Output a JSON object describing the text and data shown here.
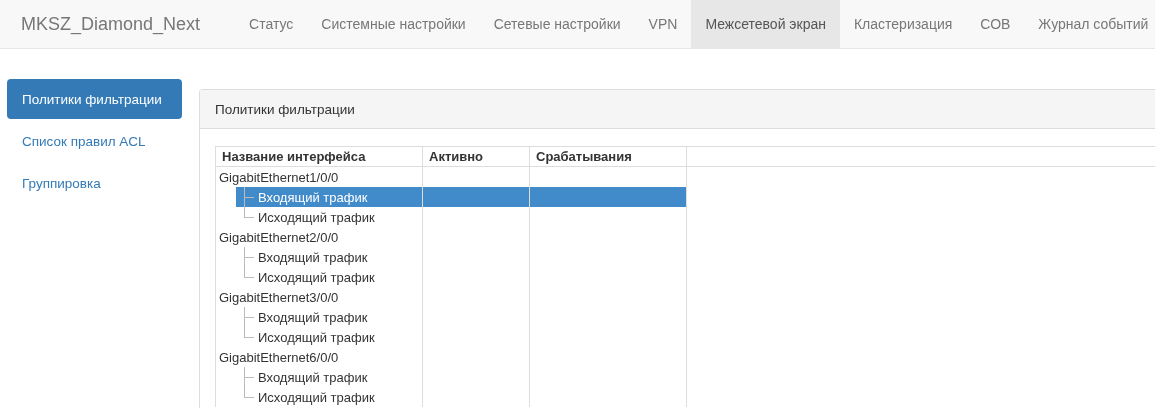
{
  "navbar": {
    "brand": "MKSZ_Diamond_Next",
    "tabs": [
      {
        "label": "Статус",
        "selected": false
      },
      {
        "label": "Системные настройки",
        "selected": false
      },
      {
        "label": "Сетевые настройки",
        "selected": false
      },
      {
        "label": "VPN",
        "selected": false
      },
      {
        "label": "Межсетевой экран",
        "selected": true
      },
      {
        "label": "Кластеризация",
        "selected": false
      },
      {
        "label": "СОВ",
        "selected": false
      },
      {
        "label": "Журнал событий",
        "selected": false
      }
    ]
  },
  "sidebar": {
    "items": [
      {
        "label": "Политики фильтрации",
        "selected": true
      },
      {
        "label": "Список правил ACL",
        "selected": false
      },
      {
        "label": "Группировка",
        "selected": false
      }
    ]
  },
  "panel": {
    "title": "Политики фильтрации"
  },
  "table": {
    "columns": [
      "Название интерфейса",
      "Активно",
      "Срабатывания"
    ],
    "rows": [
      {
        "name": "GigabitEthernet1/0/0",
        "children": [
          {
            "name": "Входящий трафик",
            "selected": true
          },
          {
            "name": "Исходящий трафик",
            "selected": false
          }
        ]
      },
      {
        "name": "GigabitEthernet2/0/0",
        "children": [
          {
            "name": "Входящий трафик",
            "selected": false
          },
          {
            "name": "Исходящий трафик",
            "selected": false
          }
        ]
      },
      {
        "name": "GigabitEthernet3/0/0",
        "children": [
          {
            "name": "Входящий трафик",
            "selected": false
          },
          {
            "name": "Исходящий трафик",
            "selected": false
          }
        ]
      },
      {
        "name": "GigabitEthernet6/0/0",
        "children": [
          {
            "name": "Входящий трафик",
            "selected": false
          },
          {
            "name": "Исходящий трафик",
            "selected": false
          }
        ]
      }
    ]
  }
}
